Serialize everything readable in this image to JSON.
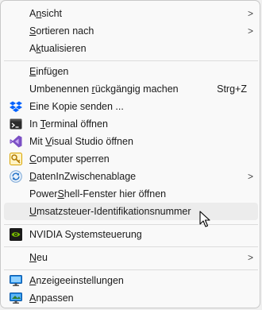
{
  "menu": {
    "items": [
      {
        "pre": "A",
        "ul": "n",
        "post": "sicht",
        "submenu": true
      },
      {
        "pre": "",
        "ul": "S",
        "post": "ortieren nach",
        "submenu": true
      },
      {
        "pre": "A",
        "ul": "k",
        "post": "tualisieren"
      },
      {
        "pre": "",
        "ul": "E",
        "post": "infügen"
      },
      {
        "pre": "Umbenennen ",
        "ul": "r",
        "post": "ückgängig machen",
        "shortcut": "Strg+Z"
      },
      {
        "pre": "Eine Kopie senden ...",
        "ul": "",
        "post": "",
        "icon": "dropbox-icon"
      },
      {
        "pre": "In ",
        "ul": "T",
        "post": "erminal öffnen",
        "icon": "terminal-icon"
      },
      {
        "pre": "Mit ",
        "ul": "V",
        "post": "isual Studio öffnen",
        "icon": "visual-studio-icon"
      },
      {
        "pre": "",
        "ul": "C",
        "post": "omputer sperren",
        "icon": "key-lock-icon"
      },
      {
        "pre": "",
        "ul": "D",
        "post": "atenInZwischenablage",
        "icon": "clipboard-sync-icon",
        "submenu": true
      },
      {
        "pre": "Power",
        "ul": "S",
        "post": "hell-Fenster hier öffnen"
      },
      {
        "pre": "",
        "ul": "U",
        "post": "msatzsteuer-Identifikationsnummer"
      },
      {
        "pre": "NVIDIA Systemsteuerung",
        "ul": "",
        "post": "",
        "icon": "nvidia-icon"
      },
      {
        "pre": "",
        "ul": "N",
        "post": "eu",
        "submenu": true
      },
      {
        "pre": "",
        "ul": "A",
        "post": "nzeigeeinstellungen",
        "icon": "display-settings-icon"
      },
      {
        "pre": "",
        "ul": "A",
        "post": "npassen",
        "icon": "personalize-icon"
      }
    ],
    "chevron": ">"
  }
}
